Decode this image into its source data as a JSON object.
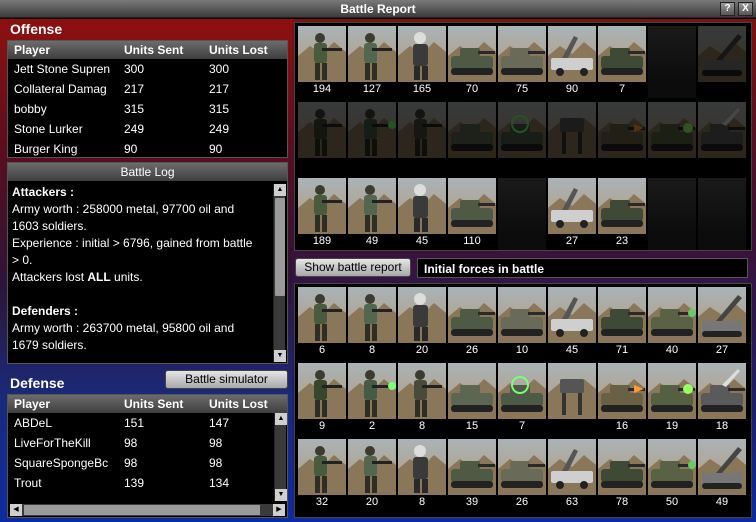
{
  "window": {
    "title": "Battle Report",
    "help_label": "?",
    "close_label": "X"
  },
  "offense": {
    "title": "Offense",
    "columns": [
      "Player",
      "Units Sent",
      "Units Lost"
    ],
    "rows": [
      [
        "Jett Stone Supren",
        "300",
        "300"
      ],
      [
        "Collateral Damag",
        "217",
        "217"
      ],
      [
        "bobby",
        "315",
        "315"
      ],
      [
        "Stone Lurker",
        "249",
        "249"
      ],
      [
        "Burger King",
        "90",
        "90"
      ]
    ]
  },
  "battle_log": {
    "title": "Battle Log",
    "lines": [
      {
        "text": "Attackers :",
        "bold": true
      },
      {
        "text": "Army worth : 258000 metal, 97700 oil and",
        "bold": false
      },
      {
        "text": "1603 soldiers.",
        "bold": false
      },
      {
        "text": "Experience : initial > 6796, gained from battle",
        "bold": false
      },
      {
        "text": "> 0.",
        "bold": false
      },
      {
        "text": "Attackers lost ",
        "bold": false,
        "bold_suffix": "ALL",
        "suffix": " units."
      },
      {
        "text": "",
        "bold": false
      },
      {
        "text": "Defenders :",
        "bold": true
      },
      {
        "text": "Army worth : 263700 metal, 95800 oil and",
        "bold": false
      },
      {
        "text": "1679 soldiers.",
        "bold": false
      }
    ]
  },
  "defense": {
    "title": "Defense",
    "simulator_label": "Battle simulator",
    "columns": [
      "Player",
      "Units Sent",
      "Units Lost"
    ],
    "rows": [
      [
        "ABDeL",
        "151",
        "147"
      ],
      [
        "LiveForTheKill",
        "98",
        "98"
      ],
      [
        "SquareSpongeBc",
        "98",
        "98"
      ],
      [
        "Trout",
        "139",
        "134"
      ]
    ]
  },
  "controls": {
    "show_report_label": "Show battle report",
    "forces_label": "Initial forces in battle"
  },
  "attacker_units": [
    [
      {
        "icon": "rifleman-icon",
        "count": "194"
      },
      {
        "icon": "gunner-icon",
        "count": "127"
      },
      {
        "icon": "armored-trooper-icon",
        "count": "165"
      },
      {
        "icon": "armored-car-icon",
        "count": "70"
      },
      {
        "icon": "light-tank-icon",
        "count": "75"
      },
      {
        "icon": "missile-truck-icon",
        "count": "90"
      },
      {
        "icon": "heavy-tank-icon",
        "count": "7"
      },
      {
        "icon": "empty-slot-icon",
        "count": ""
      },
      {
        "icon": "artillery-icon",
        "count": ""
      }
    ],
    [
      {
        "icon": "sniper-icon",
        "count": ""
      },
      {
        "icon": "rocket-soldier-icon",
        "count": ""
      },
      {
        "icon": "bazooka-soldier-icon",
        "count": ""
      },
      {
        "icon": "apc-icon",
        "count": ""
      },
      {
        "icon": "sonic-tank-icon",
        "count": ""
      },
      {
        "icon": "mech-walker-icon",
        "count": ""
      },
      {
        "icon": "flame-tank-icon",
        "count": ""
      },
      {
        "icon": "laser-tank-icon",
        "count": ""
      },
      {
        "icon": "siege-tank-icon",
        "count": ""
      }
    ],
    [
      {
        "icon": "rifleman-icon",
        "count": "189"
      },
      {
        "icon": "gunner-icon",
        "count": "49"
      },
      {
        "icon": "armored-trooper-icon",
        "count": "45"
      },
      {
        "icon": "armored-car-icon",
        "count": "110"
      },
      {
        "icon": "empty-slot-icon",
        "count": ""
      },
      {
        "icon": "missile-truck-icon",
        "count": "27"
      },
      {
        "icon": "heavy-tank-icon",
        "count": "23"
      },
      {
        "icon": "empty-slot-icon",
        "count": ""
      },
      {
        "icon": "empty-slot-icon",
        "count": ""
      }
    ]
  ],
  "defender_units": [
    [
      {
        "icon": "rifleman-icon",
        "count": "6"
      },
      {
        "icon": "gunner-icon",
        "count": "8"
      },
      {
        "icon": "armored-trooper-icon",
        "count": "20"
      },
      {
        "icon": "armored-car-icon",
        "count": "26"
      },
      {
        "icon": "light-tank-icon",
        "count": "10"
      },
      {
        "icon": "missile-truck-icon",
        "count": "45"
      },
      {
        "icon": "heavy-tank-icon",
        "count": "71"
      },
      {
        "icon": "tank-destroyer-icon",
        "count": "40"
      },
      {
        "icon": "artillery-icon",
        "count": "27"
      }
    ],
    [
      {
        "icon": "sniper-icon",
        "count": "9"
      },
      {
        "icon": "rocket-soldier-icon",
        "count": "2"
      },
      {
        "icon": "bazooka-soldier-icon",
        "count": "8"
      },
      {
        "icon": "apc-icon",
        "count": "15"
      },
      {
        "icon": "sonic-tank-icon",
        "count": "7"
      },
      {
        "icon": "mech-walker-icon",
        "count": ""
      },
      {
        "icon": "flame-tank-icon",
        "count": "16"
      },
      {
        "icon": "laser-tank-icon",
        "count": "19"
      },
      {
        "icon": "siege-tank-icon",
        "count": "18"
      }
    ],
    [
      {
        "icon": "rifleman-icon",
        "count": "32"
      },
      {
        "icon": "gunner-icon",
        "count": "20"
      },
      {
        "icon": "armored-trooper-icon",
        "count": "8"
      },
      {
        "icon": "armored-car-icon",
        "count": "39"
      },
      {
        "icon": "light-tank-icon",
        "count": "26"
      },
      {
        "icon": "missile-truck-icon",
        "count": "63"
      },
      {
        "icon": "heavy-tank-icon",
        "count": "78"
      },
      {
        "icon": "tank-destroyer-icon",
        "count": "50"
      },
      {
        "icon": "artillery-icon",
        "count": "49"
      }
    ]
  ],
  "colors": {
    "offense_red": "#8e1010",
    "defense_blue": "#0e2aa0",
    "panel_black": "#000000",
    "header_gray": "#5a5a5a"
  }
}
